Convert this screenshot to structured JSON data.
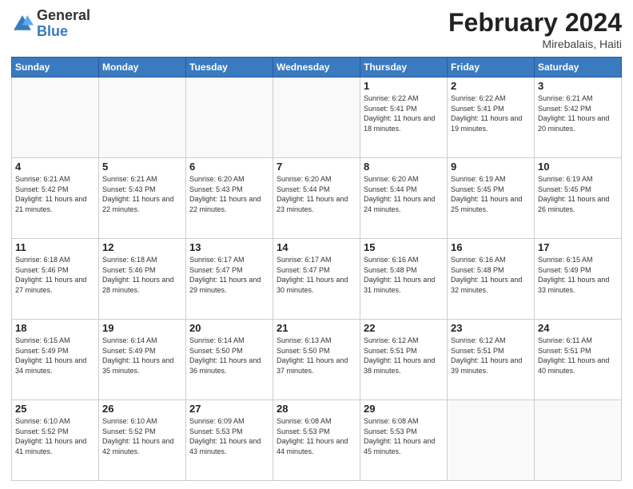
{
  "header": {
    "logo_general": "General",
    "logo_blue": "Blue",
    "title": "February 2024",
    "location": "Mirebalais, Haiti"
  },
  "days_of_week": [
    "Sunday",
    "Monday",
    "Tuesday",
    "Wednesday",
    "Thursday",
    "Friday",
    "Saturday"
  ],
  "weeks": [
    [
      {
        "day": "",
        "info": ""
      },
      {
        "day": "",
        "info": ""
      },
      {
        "day": "",
        "info": ""
      },
      {
        "day": "",
        "info": ""
      },
      {
        "day": "1",
        "info": "Sunrise: 6:22 AM\nSunset: 5:41 PM\nDaylight: 11 hours and 18 minutes."
      },
      {
        "day": "2",
        "info": "Sunrise: 6:22 AM\nSunset: 5:41 PM\nDaylight: 11 hours and 19 minutes."
      },
      {
        "day": "3",
        "info": "Sunrise: 6:21 AM\nSunset: 5:42 PM\nDaylight: 11 hours and 20 minutes."
      }
    ],
    [
      {
        "day": "4",
        "info": "Sunrise: 6:21 AM\nSunset: 5:42 PM\nDaylight: 11 hours and 21 minutes."
      },
      {
        "day": "5",
        "info": "Sunrise: 6:21 AM\nSunset: 5:43 PM\nDaylight: 11 hours and 22 minutes."
      },
      {
        "day": "6",
        "info": "Sunrise: 6:20 AM\nSunset: 5:43 PM\nDaylight: 11 hours and 22 minutes."
      },
      {
        "day": "7",
        "info": "Sunrise: 6:20 AM\nSunset: 5:44 PM\nDaylight: 11 hours and 23 minutes."
      },
      {
        "day": "8",
        "info": "Sunrise: 6:20 AM\nSunset: 5:44 PM\nDaylight: 11 hours and 24 minutes."
      },
      {
        "day": "9",
        "info": "Sunrise: 6:19 AM\nSunset: 5:45 PM\nDaylight: 11 hours and 25 minutes."
      },
      {
        "day": "10",
        "info": "Sunrise: 6:19 AM\nSunset: 5:45 PM\nDaylight: 11 hours and 26 minutes."
      }
    ],
    [
      {
        "day": "11",
        "info": "Sunrise: 6:18 AM\nSunset: 5:46 PM\nDaylight: 11 hours and 27 minutes."
      },
      {
        "day": "12",
        "info": "Sunrise: 6:18 AM\nSunset: 5:46 PM\nDaylight: 11 hours and 28 minutes."
      },
      {
        "day": "13",
        "info": "Sunrise: 6:17 AM\nSunset: 5:47 PM\nDaylight: 11 hours and 29 minutes."
      },
      {
        "day": "14",
        "info": "Sunrise: 6:17 AM\nSunset: 5:47 PM\nDaylight: 11 hours and 30 minutes."
      },
      {
        "day": "15",
        "info": "Sunrise: 6:16 AM\nSunset: 5:48 PM\nDaylight: 11 hours and 31 minutes."
      },
      {
        "day": "16",
        "info": "Sunrise: 6:16 AM\nSunset: 5:48 PM\nDaylight: 11 hours and 32 minutes."
      },
      {
        "day": "17",
        "info": "Sunrise: 6:15 AM\nSunset: 5:49 PM\nDaylight: 11 hours and 33 minutes."
      }
    ],
    [
      {
        "day": "18",
        "info": "Sunrise: 6:15 AM\nSunset: 5:49 PM\nDaylight: 11 hours and 34 minutes."
      },
      {
        "day": "19",
        "info": "Sunrise: 6:14 AM\nSunset: 5:49 PM\nDaylight: 11 hours and 35 minutes."
      },
      {
        "day": "20",
        "info": "Sunrise: 6:14 AM\nSunset: 5:50 PM\nDaylight: 11 hours and 36 minutes."
      },
      {
        "day": "21",
        "info": "Sunrise: 6:13 AM\nSunset: 5:50 PM\nDaylight: 11 hours and 37 minutes."
      },
      {
        "day": "22",
        "info": "Sunrise: 6:12 AM\nSunset: 5:51 PM\nDaylight: 11 hours and 38 minutes."
      },
      {
        "day": "23",
        "info": "Sunrise: 6:12 AM\nSunset: 5:51 PM\nDaylight: 11 hours and 39 minutes."
      },
      {
        "day": "24",
        "info": "Sunrise: 6:11 AM\nSunset: 5:51 PM\nDaylight: 11 hours and 40 minutes."
      }
    ],
    [
      {
        "day": "25",
        "info": "Sunrise: 6:10 AM\nSunset: 5:52 PM\nDaylight: 11 hours and 41 minutes."
      },
      {
        "day": "26",
        "info": "Sunrise: 6:10 AM\nSunset: 5:52 PM\nDaylight: 11 hours and 42 minutes."
      },
      {
        "day": "27",
        "info": "Sunrise: 6:09 AM\nSunset: 5:53 PM\nDaylight: 11 hours and 43 minutes."
      },
      {
        "day": "28",
        "info": "Sunrise: 6:08 AM\nSunset: 5:53 PM\nDaylight: 11 hours and 44 minutes."
      },
      {
        "day": "29",
        "info": "Sunrise: 6:08 AM\nSunset: 5:53 PM\nDaylight: 11 hours and 45 minutes."
      },
      {
        "day": "",
        "info": ""
      },
      {
        "day": "",
        "info": ""
      }
    ]
  ]
}
